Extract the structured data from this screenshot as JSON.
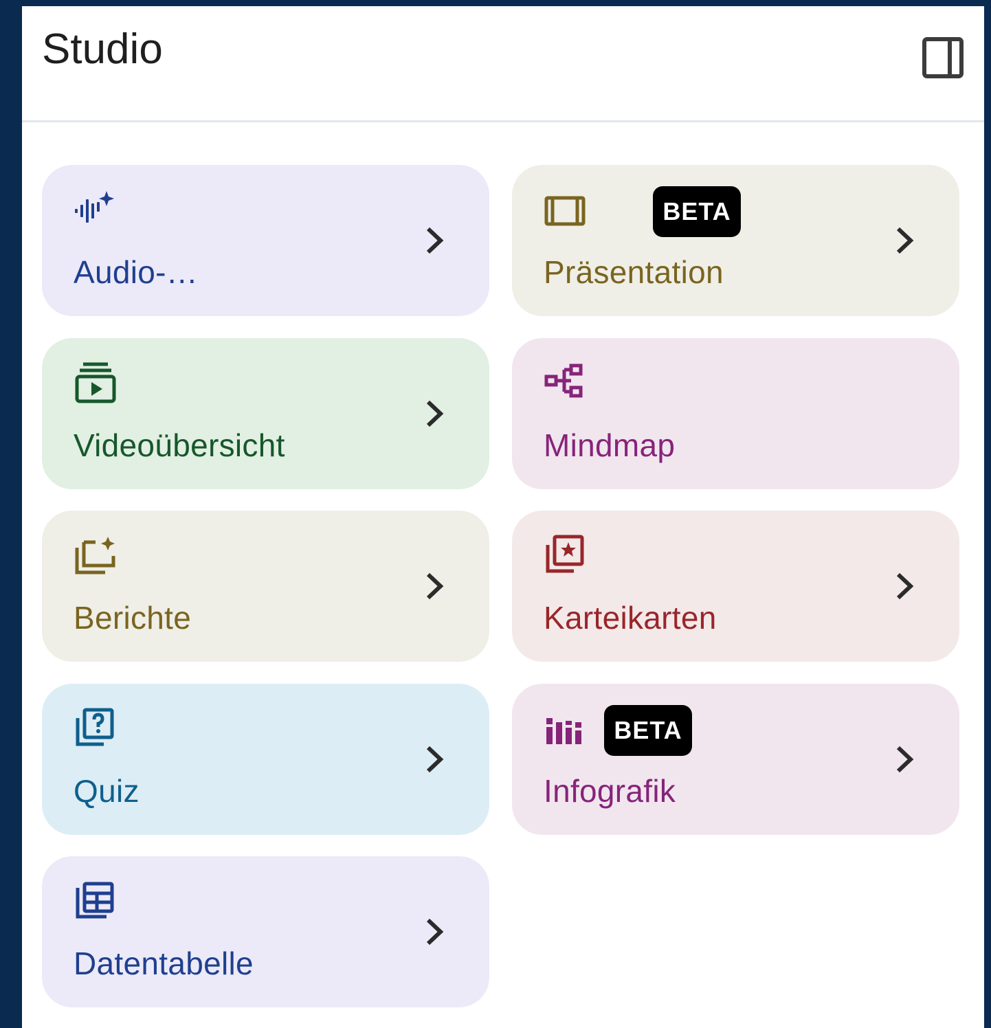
{
  "panel": {
    "title": "Studio",
    "toggle_icon": "dock-to-right-icon"
  },
  "cards": [
    {
      "label": "Audio-…",
      "icon": "audio-spark-icon",
      "color": "#1f3f8f",
      "bg": "#eceaf8",
      "has_chevron": true
    },
    {
      "label": "Präsentation",
      "icon": "slides-icon",
      "color": "#7a6420",
      "bg": "#efefe7",
      "badge": "BETA",
      "has_chevron": true
    },
    {
      "label": "Videoübersicht",
      "icon": "video-library-icon",
      "color": "#17572b",
      "bg": "#e2efe3",
      "has_chevron": true
    },
    {
      "label": "Mindmap",
      "icon": "mindmap-icon",
      "color": "#86247a",
      "bg": "#f1e6ee",
      "has_chevron": false
    },
    {
      "label": "Berichte",
      "icon": "reports-icon",
      "color": "#7a6420",
      "bg": "#efefe7",
      "has_chevron": true
    },
    {
      "label": "Karteikarten",
      "icon": "flashcards-icon",
      "color": "#99262a",
      "bg": "#f4e9e9",
      "has_chevron": true
    },
    {
      "label": "Quiz",
      "icon": "quiz-icon",
      "color": "#0f5f8c",
      "bg": "#dcedf5",
      "has_chevron": true
    },
    {
      "label": "Infografik",
      "icon": "infographic-icon",
      "color": "#86247a",
      "bg": "#f1e6ee",
      "badge": "BETA",
      "has_chevron": true
    },
    {
      "label": "Datentabelle",
      "icon": "data-table-icon",
      "color": "#1f3f8f",
      "bg": "#eceaf8",
      "has_chevron": true
    }
  ]
}
